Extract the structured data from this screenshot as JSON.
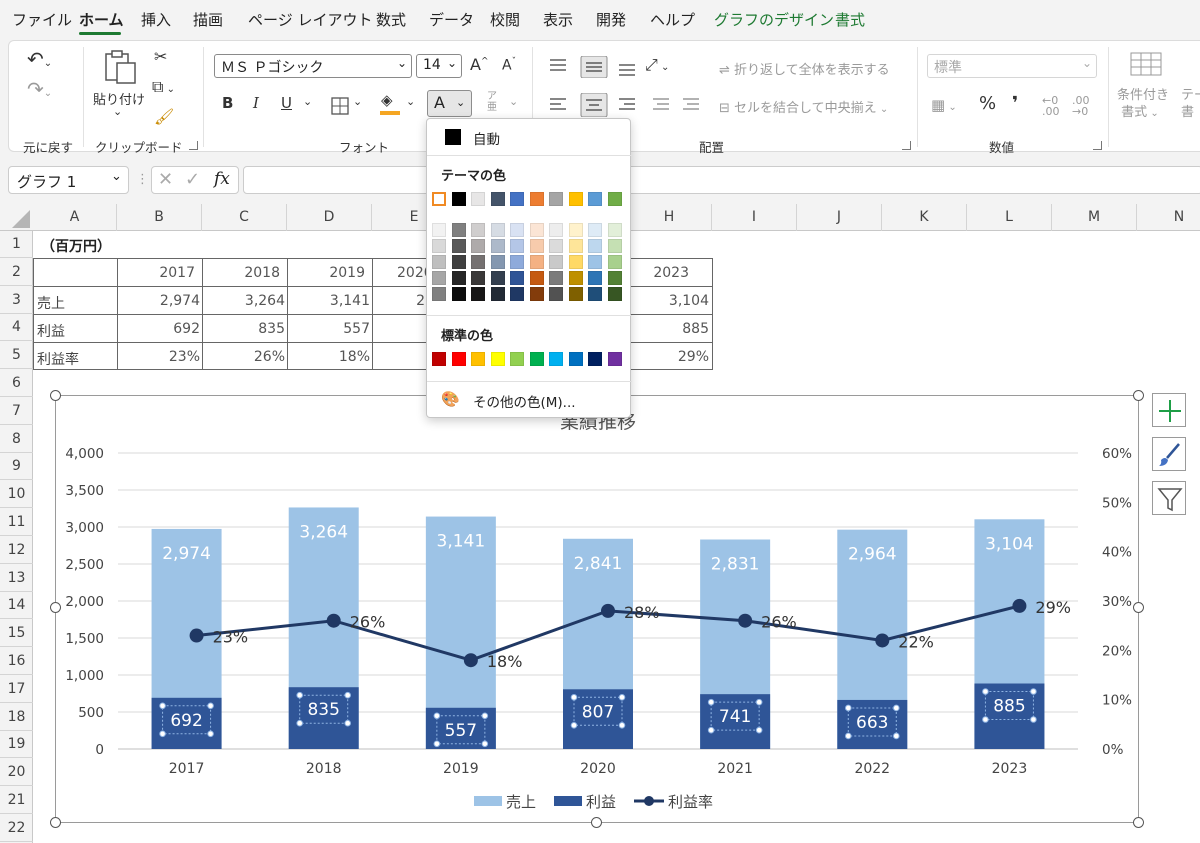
{
  "menu": {
    "tabs": [
      "ファイル",
      "ホーム",
      "挿入",
      "描画",
      "ページ レイアウト",
      "数式",
      "データ",
      "校閲",
      "表示",
      "開発",
      "ヘルプ",
      "グラフのデザイン",
      "書式"
    ],
    "active_tab": "ホーム"
  },
  "ribbon": {
    "undo_group": "元に戻す",
    "clipboard": {
      "paste": "貼り付け",
      "label": "クリップボード"
    },
    "font": {
      "name": "ＭＳ Ｐゴシック",
      "size": "14",
      "label": "フォント",
      "bold": "B",
      "italic": "I",
      "underline": "U",
      "font_color_glyph": "A",
      "grow": "A",
      "shrink": "A"
    },
    "alignment": {
      "wrap_text": "折り返して全体を表示する",
      "merge_center": "セルを結合して中央揃え",
      "label": "配置"
    },
    "number": {
      "format": "標準",
      "label": "数値",
      "percent": "%",
      "comma": "❜"
    },
    "styles": {
      "conditional": "条件付き",
      "conditional2": "書式"
    }
  },
  "formula_bar": {
    "name_box": "グラフ 1",
    "fx": "fx",
    "value": ""
  },
  "columns": [
    "A",
    "B",
    "C",
    "D",
    "E",
    "F",
    "G",
    "H",
    "I",
    "J",
    "K",
    "L",
    "M",
    "N"
  ],
  "rows": [
    "1",
    "2",
    "3",
    "4",
    "5",
    "6",
    "7",
    "8",
    "9",
    "10",
    "11",
    "12",
    "13",
    "14",
    "15",
    "16",
    "17",
    "18",
    "19",
    "20",
    "21",
    "22"
  ],
  "sheet": {
    "unit_label": "（百万円）",
    "years": [
      "2017",
      "2018",
      "2019",
      "2020",
      "2023"
    ],
    "row_labels": [
      "売上",
      "利益",
      "利益率"
    ],
    "sales": [
      "2,974",
      "3,264",
      "3,141",
      "2",
      "3,104"
    ],
    "profit": [
      "692",
      "835",
      "557",
      "885"
    ],
    "rate": [
      "23%",
      "26%",
      "18%",
      "29%"
    ]
  },
  "chart_data": {
    "type": "bar",
    "title": "業績推移",
    "categories": [
      "2017",
      "2018",
      "2019",
      "2020",
      "2021",
      "2022",
      "2023"
    ],
    "series": [
      {
        "name": "売上",
        "type": "bar",
        "axis": "left",
        "values": [
          2974,
          3264,
          3141,
          2841,
          2831,
          2964,
          3104
        ],
        "labels": [
          "2,974",
          "3,264",
          "3,141",
          "2,841",
          "2,831",
          "2,964",
          "3,104"
        ],
        "color": "#9dc3e6"
      },
      {
        "name": "利益",
        "type": "bar",
        "axis": "left",
        "values": [
          692,
          835,
          557,
          807,
          741,
          663,
          885
        ],
        "labels": [
          "692",
          "835",
          "557",
          "807",
          "741",
          "663",
          "885"
        ],
        "color": "#2f5597"
      },
      {
        "name": "利益率",
        "type": "line",
        "axis": "right",
        "values": [
          23,
          26,
          18,
          28,
          26,
          22,
          29
        ],
        "labels": [
          "23%",
          "26%",
          "18%",
          "28%",
          "26%",
          "22%",
          "29%"
        ],
        "color": "#203864"
      }
    ],
    "y_left": {
      "min": 0,
      "max": 4000,
      "ticks": [
        "0",
        "500",
        "1,000",
        "1,500",
        "2,000",
        "2,500",
        "3,000",
        "3,500",
        "4,000"
      ]
    },
    "y_right": {
      "min": 0,
      "max": 60,
      "ticks": [
        "0%",
        "10%",
        "20%",
        "30%",
        "40%",
        "50%",
        "60%"
      ]
    },
    "grid": true,
    "legend_position": "bottom"
  },
  "color_menu": {
    "automatic": "自動",
    "theme_colors": "テーマの色",
    "standard_colors": "標準の色",
    "more_colors": "その他の色(M)...",
    "theme_top": [
      "#ffffff",
      "#000000",
      "#e7e6e6",
      "#44546a",
      "#4472c4",
      "#ed7d31",
      "#a5a5a5",
      "#ffc000",
      "#5b9bd5",
      "#70ad47"
    ],
    "theme_shades": [
      [
        "#f2f2f2",
        "#d9d9d9",
        "#bfbfbf",
        "#a6a6a6",
        "#808080"
      ],
      [
        "#808080",
        "#595959",
        "#404040",
        "#262626",
        "#0d0d0d"
      ],
      [
        "#d0cece",
        "#aeaaaa",
        "#757171",
        "#3a3838",
        "#171616"
      ],
      [
        "#d6dce4",
        "#adb9ca",
        "#8497b0",
        "#333f4f",
        "#222a35"
      ],
      [
        "#d9e2f3",
        "#b4c6e7",
        "#8eaadb",
        "#2f5496",
        "#1f3864"
      ],
      [
        "#fbe5d5",
        "#f7cbac",
        "#f4b183",
        "#c55a11",
        "#833c0b"
      ],
      [
        "#ededed",
        "#dbdbdb",
        "#c9c9c9",
        "#7b7b7b",
        "#525252"
      ],
      [
        "#fff2cc",
        "#fee599",
        "#ffd965",
        "#bf9000",
        "#7f6000"
      ],
      [
        "#deebf6",
        "#bdd7ee",
        "#9dc3e6",
        "#2e75b5",
        "#1f4e79"
      ],
      [
        "#e2efd9",
        "#c5e0b3",
        "#a8d08d",
        "#538135",
        "#375623"
      ]
    ],
    "standard": [
      "#c00000",
      "#ff0000",
      "#ffc000",
      "#ffff00",
      "#92d050",
      "#00b050",
      "#00b0f0",
      "#0070c0",
      "#002060",
      "#7030a0"
    ]
  }
}
